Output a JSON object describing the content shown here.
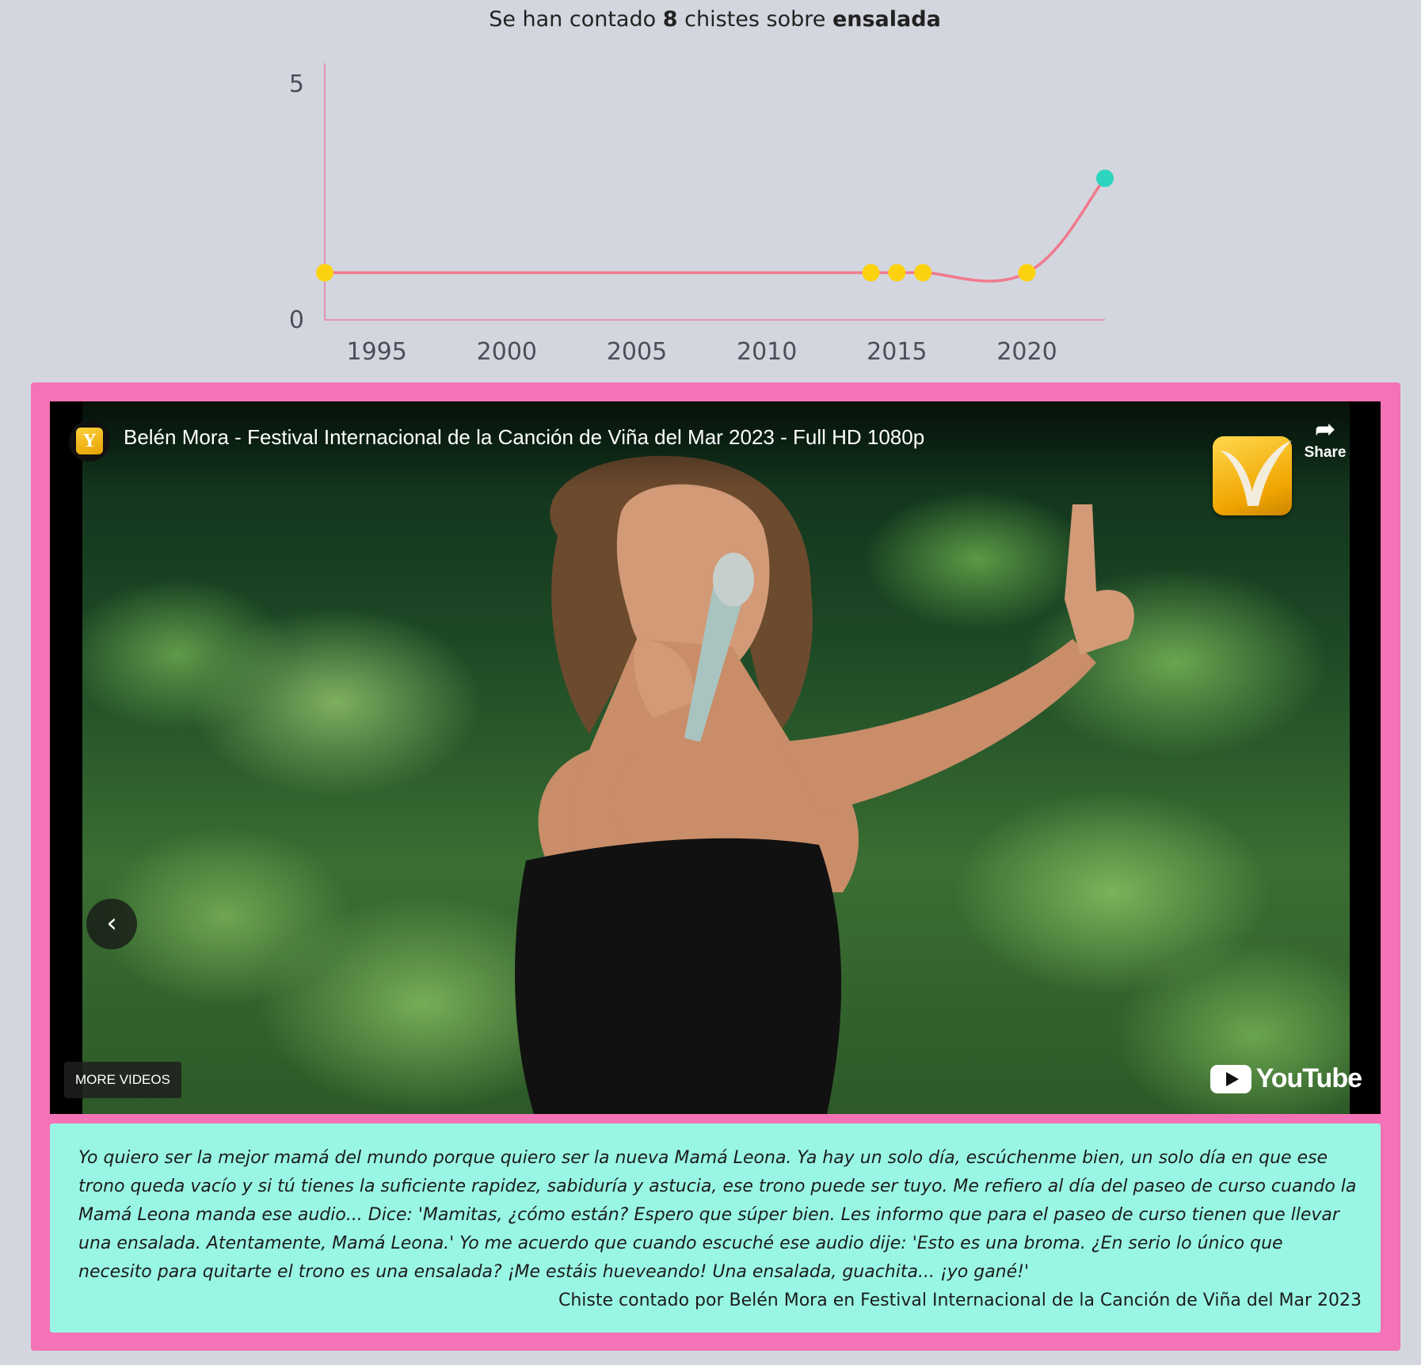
{
  "headline": {
    "prefix": "Se han contado",
    "count": "8",
    "middle": "chistes sobre",
    "topic": "ensalada"
  },
  "chart_data": {
    "type": "line",
    "title": "",
    "xlabel": "",
    "ylabel": "",
    "x_ticks": [
      "1995",
      "2000",
      "2005",
      "2010",
      "2015",
      "2020"
    ],
    "y_ticks": [
      "0",
      "5"
    ],
    "xlim": [
      1993,
      2023
    ],
    "ylim": [
      0,
      5
    ],
    "grid": false,
    "series": [
      {
        "x": [
          1993,
          2014,
          2015,
          2016,
          2020,
          2023
        ],
        "y": [
          1,
          1,
          1,
          1,
          1,
          3
        ]
      }
    ],
    "line_color": "#f2798d",
    "point_color": "#fcd20f",
    "highlight_point_color": "#2dd4bf",
    "axis_color": "#ea7fa8"
  },
  "video": {
    "title": "Belén Mora - Festival Internacional de la Canción de Viña del Mar 2023 - Full HD 1080p",
    "share_label": "Share",
    "more_videos_label": "MORE VIDEOS",
    "youtube_label": "YouTube",
    "channel_icon": "channel-avatar-icon",
    "prev_icon": "chevron-left-icon",
    "share_icon": "share-arrow-icon",
    "prev_glyph": "‹",
    "share_glyph": "➦",
    "channel_glyph": "Y"
  },
  "quote": {
    "text": "Yo quiero ser la mejor mamá del mundo porque quiero ser la nueva Mamá Leona. Ya hay un solo día, escúchenme bien, un solo día en que ese trono queda vacío y si tú tienes la suficiente rapidez, sabiduría y astucia, ese trono puede ser tuyo. Me refiero al día del paseo de curso cuando la Mamá Leona manda ese audio... Dice: 'Mamitas, ¿cómo están? Espero que súper bien. Les informo que para el paseo de curso tienen que llevar una ensalada. Atentamente, Mamá Leona.' Yo me acuerdo que cuando escuché ese audio dije: 'Esto es una broma. ¿En serio lo único que necesito para quitarte el trono es una ensalada? ¡Me estáis hueveando! Una ensalada, guachita... ¡yo gané!'",
    "attribution": "Chiste contado por Belén Mora en Festival Internacional de la Canción de Viña del Mar 2023"
  },
  "colors": {
    "page_background": "#d3d6de",
    "card_border": "#f472b6",
    "quote_background": "#99f6e4"
  }
}
